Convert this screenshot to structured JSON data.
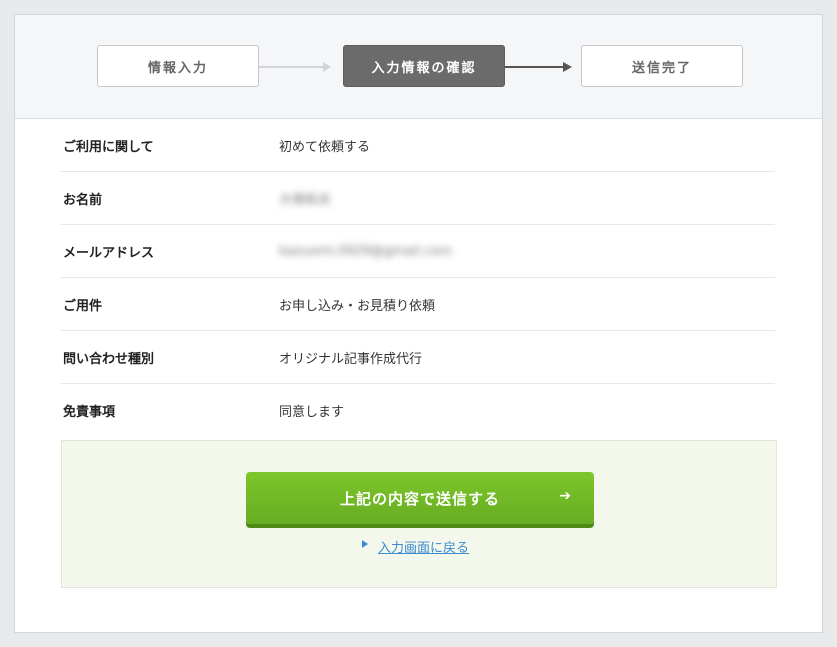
{
  "steps": [
    {
      "label": "情報入力",
      "state": "done"
    },
    {
      "label": "入力情報の確認",
      "state": "current"
    },
    {
      "label": "送信完了",
      "state": "todo"
    }
  ],
  "confirm_rows": [
    {
      "label": "ご利用に関して",
      "value": "初めて依頼する",
      "blurred": false
    },
    {
      "label": "お名前",
      "value": "大塚和夫",
      "blurred": true
    },
    {
      "label": "メールアドレス",
      "value": "kazuomi.0929@gmail.com",
      "blurred": true
    },
    {
      "label": "ご用件",
      "value": "お申し込み・お見積り依頼",
      "blurred": false
    },
    {
      "label": "問い合わせ種別",
      "value": "オリジナル記事作成代行",
      "blurred": false
    },
    {
      "label": "免責事項",
      "value": "同意します",
      "blurred": false
    }
  ],
  "actions": {
    "submit_label": "上記の内容で送信する",
    "submit_arrow": "➔",
    "back_label": "入力画面に戻る"
  },
  "colors": {
    "accent_green": "#70b827",
    "link_blue": "#3a8bd0",
    "active_step": "#6b6b6b"
  }
}
